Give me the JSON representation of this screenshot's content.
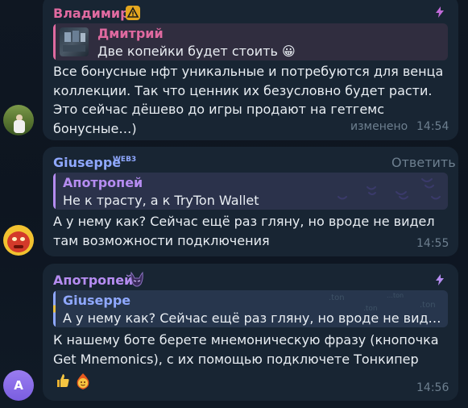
{
  "messages": [
    {
      "sender": "Владимир",
      "sender_color": "#e06aa0",
      "badge_icon": "warning-badge-icon",
      "status_icon": "bolt-icon",
      "reply": {
        "name": "Дмитрий",
        "text": "Две копейки будет стоить 😀",
        "color": "#e06aa0"
      },
      "text": "Все бонусные нфт уникальные и потребуются для венца коллекции. Так что ценник их безусловно будет расти. Это сейчас дёшево до игры продают на гетгемс бонусные…)",
      "edited": "изменено",
      "time": "14:54"
    },
    {
      "sender": "Giuseppe",
      "sender_color": "#8fa8ff",
      "sender_badge": "WEB3",
      "action": "Ответить",
      "reply": {
        "name": "Апотропей",
        "text": "Не к трасту, а к TryTon Wallet",
        "color": "#b58cf0"
      },
      "text": "А у нему как? Сейчас ещё раз гляну, но вроде не видел там возможности подключения",
      "time": "14:55"
    },
    {
      "sender": "Апотропей",
      "sender_color": "#b58cf0",
      "status_icon": "bolt-icon",
      "reply": {
        "name": "Giuseppe",
        "text": "А у нему как? Сейчас ещё раз гляну, но вроде не видел там возможности подключения",
        "color": "#8fa8ff",
        "bg_labels": [
          ".ton",
          ".ton",
          ".ton",
          "…ton"
        ]
      },
      "text": "К нашему боте берете мнемоническую фразу (кнопочка Get Mnemonics), с их помощью подключете Тонкипер",
      "reactions": [
        "thumbs-up-icon",
        "fire-face-icon"
      ],
      "time": "14:56",
      "avatar_letter": "A"
    }
  ],
  "colors": {
    "bubble": "#182533",
    "bg": "#0e1621",
    "meta": "#6d7f8f",
    "bolt": "#c06ad8"
  }
}
